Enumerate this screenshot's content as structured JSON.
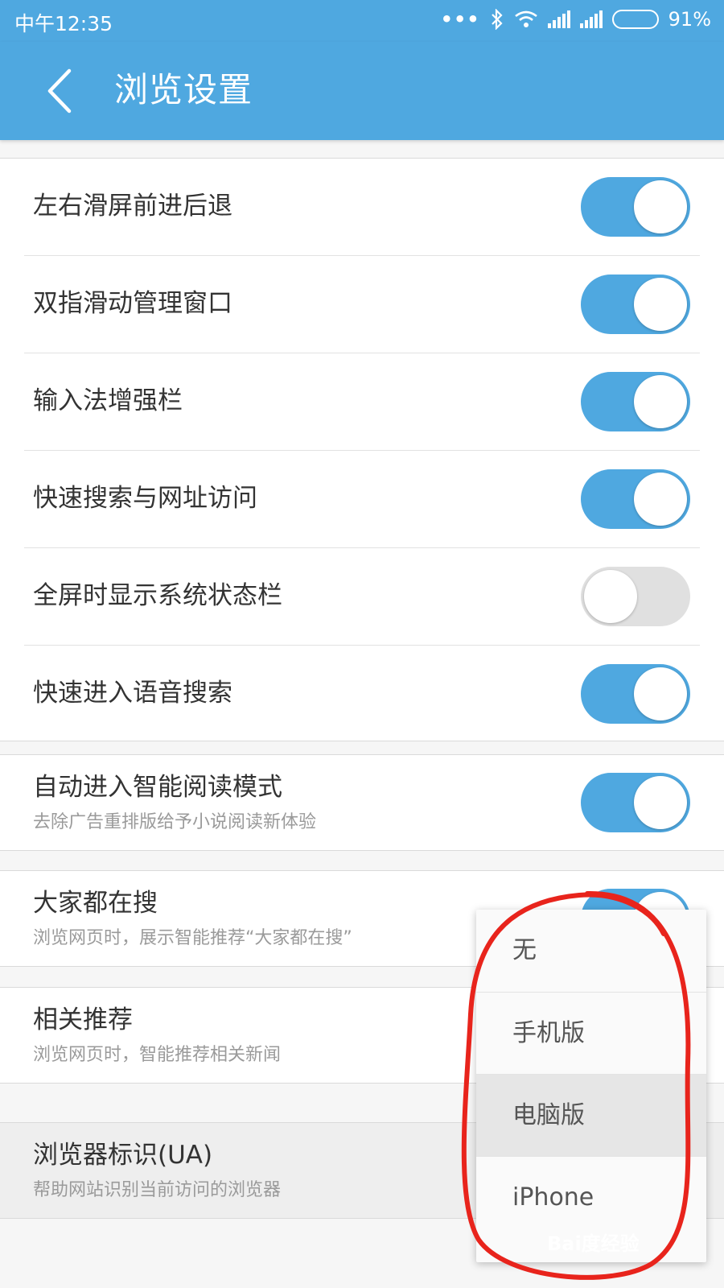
{
  "status_bar": {
    "time": "中午12:35",
    "battery": "91%",
    "battery_level": 0.91,
    "icons": [
      "more-dots-icon",
      "bluetooth-icon",
      "wifi-icon",
      "signal-icon",
      "signal-icon",
      "battery-icon"
    ]
  },
  "header": {
    "title": "浏览设置",
    "back_icon": "chevron-left-icon"
  },
  "settings": [
    {
      "label": "左右滑屏前进后退",
      "on": true
    },
    {
      "label": "双指滑动管理窗口",
      "on": true
    },
    {
      "label": "输入法增强栏",
      "on": true
    },
    {
      "label": "快速搜索与网址访问",
      "on": true
    },
    {
      "label": "全屏时显示系统状态栏",
      "on": false
    },
    {
      "label": "快速进入语音搜索",
      "on": true
    }
  ],
  "smart_reading": {
    "label": "自动进入智能阅读模式",
    "sub": "去除广告重排版给予小说阅读新体验",
    "on": true
  },
  "trending": {
    "label": "大家都在搜",
    "sub": "浏览网页时，展示智能推荐“大家都在搜”",
    "on": true
  },
  "related": {
    "label": "相关推荐",
    "sub": "浏览网页时，智能推荐相关新闻"
  },
  "ua": {
    "label": "浏览器标识(UA)",
    "sub": "帮助网站识别当前访问的浏览器"
  },
  "ua_menu": {
    "options": [
      "无",
      "手机版",
      "电脑版",
      "iPhone"
    ],
    "selected": "电脑版"
  },
  "colors": {
    "accent": "#4fa8e0",
    "annotation": "#e8241c"
  },
  "watermark": {
    "text": "Bai度经验"
  }
}
